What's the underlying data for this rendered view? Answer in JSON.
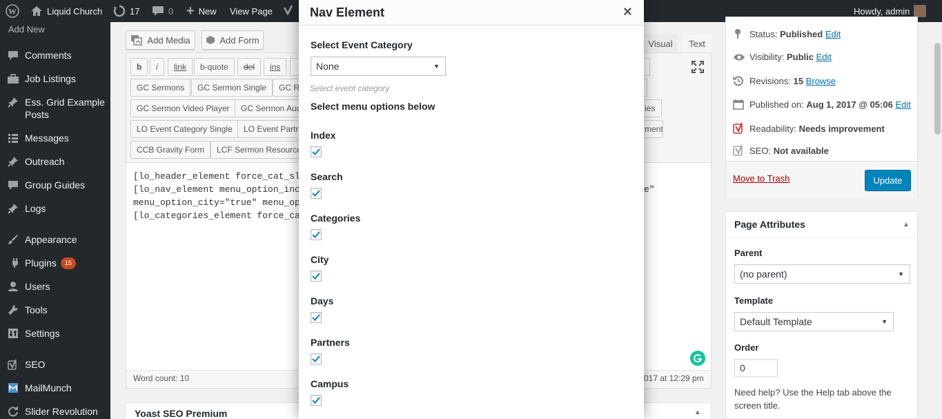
{
  "adminbar": {
    "site_name": "Liquid Church",
    "updates_count": "17",
    "comments_count": "0",
    "new_label": "New",
    "view_page_label": "View Page",
    "howdy": "Howdy, admin"
  },
  "sidebar": {
    "partial_item": "Add New",
    "items": [
      {
        "label": "Comments",
        "icon": "comment-icon"
      },
      {
        "label": "Job Listings",
        "icon": "briefcase-icon"
      },
      {
        "label": "Ess. Grid Example Posts",
        "icon": "pin-icon"
      },
      {
        "label": "Messages",
        "icon": "list-icon"
      },
      {
        "label": "Outreach",
        "icon": "pin-icon"
      },
      {
        "label": "Group Guides",
        "icon": "comment-icon"
      },
      {
        "label": "Logs",
        "icon": "pin-icon"
      },
      {
        "label": "Appearance",
        "icon": "brush-icon"
      },
      {
        "label": "Plugins",
        "icon": "plug-icon",
        "badge": "15"
      },
      {
        "label": "Users",
        "icon": "user-icon"
      },
      {
        "label": "Tools",
        "icon": "wrench-icon"
      },
      {
        "label": "Settings",
        "icon": "settings-icon"
      },
      {
        "label": "SEO",
        "icon": "yoast-icon"
      },
      {
        "label": "MailMunch",
        "icon": "mail-icon"
      },
      {
        "label": "Slider Revolution",
        "icon": "refresh-icon"
      }
    ]
  },
  "editor": {
    "add_media": "Add Media",
    "add_form": "Add Form",
    "tab_visual": "Visual",
    "tab_text": "Text",
    "quicktags": [
      "b",
      "i",
      "link",
      "b-quote",
      "del",
      "ins"
    ],
    "shortcodes_row1": [
      "GC Sermons",
      "GC Sermon Single",
      "GC Re"
    ],
    "shortcodes_row2": [
      "GC Sermon Video Player",
      "GC Sermon Aud"
    ],
    "shortcodes_row3": [
      "LO Event Category Single",
      "LO Event Partne"
    ],
    "shortcodes_row4": [
      "CCB Gravity Form",
      "LCF Sermon Resources"
    ],
    "right_partial_1": "ies",
    "right_partial_2": "ment",
    "code_lines": [
      "[lo_header_element force_cat_sl",
      "[lo_nav_element menu_option_inc",
      "menu_option_city=\"true\" menu_op",
      "[lo_categories_element force_ca"
    ],
    "code_line2_tail": "e\"",
    "word_count": "Word count: 10",
    "last_edited": "017 at 12:29 pm"
  },
  "publish": {
    "status_label": "Status:",
    "status_value": "Published",
    "visibility_label": "Visibility:",
    "visibility_value": "Public",
    "revisions_label": "Revisions:",
    "revisions_value": "15",
    "browse": "Browse",
    "published_on_label": "Published on:",
    "published_on_value": "Aug 1, 2017 @ 05:06",
    "edit": "Edit",
    "readability_label": "Readability:",
    "readability_value": "Needs improvement",
    "seo_label": "SEO:",
    "seo_value": "Not available",
    "move_to_trash": "Move to Trash",
    "update": "Update"
  },
  "page_attributes": {
    "title": "Page Attributes",
    "parent_label": "Parent",
    "parent_value": "(no parent)",
    "template_label": "Template",
    "template_value": "Default Template",
    "order_label": "Order",
    "order_value": "0",
    "help": "Need help? Use the Help tab above the screen title."
  },
  "yoast_box": {
    "title": "Yoast SEO Premium"
  },
  "modal": {
    "title": "Nav Element",
    "close": "×",
    "category_label": "Select Event Category",
    "category_value": "None",
    "category_help": "Select event category",
    "options_heading": "Select menu options below",
    "options": [
      {
        "label": "Index",
        "checked": true
      },
      {
        "label": "Search",
        "checked": true
      },
      {
        "label": "Categories",
        "checked": true
      },
      {
        "label": "City",
        "checked": true
      },
      {
        "label": "Days",
        "checked": true
      },
      {
        "label": "Partners",
        "checked": true
      },
      {
        "label": "Campus",
        "checked": true
      }
    ]
  },
  "colors": {
    "adminbar": "#23282d",
    "accent_blue": "#0073aa",
    "update_button": "#0085ba",
    "trash_red": "#a00",
    "yoast_red": "#dc3232",
    "badge_orange": "#ca4a1f"
  }
}
